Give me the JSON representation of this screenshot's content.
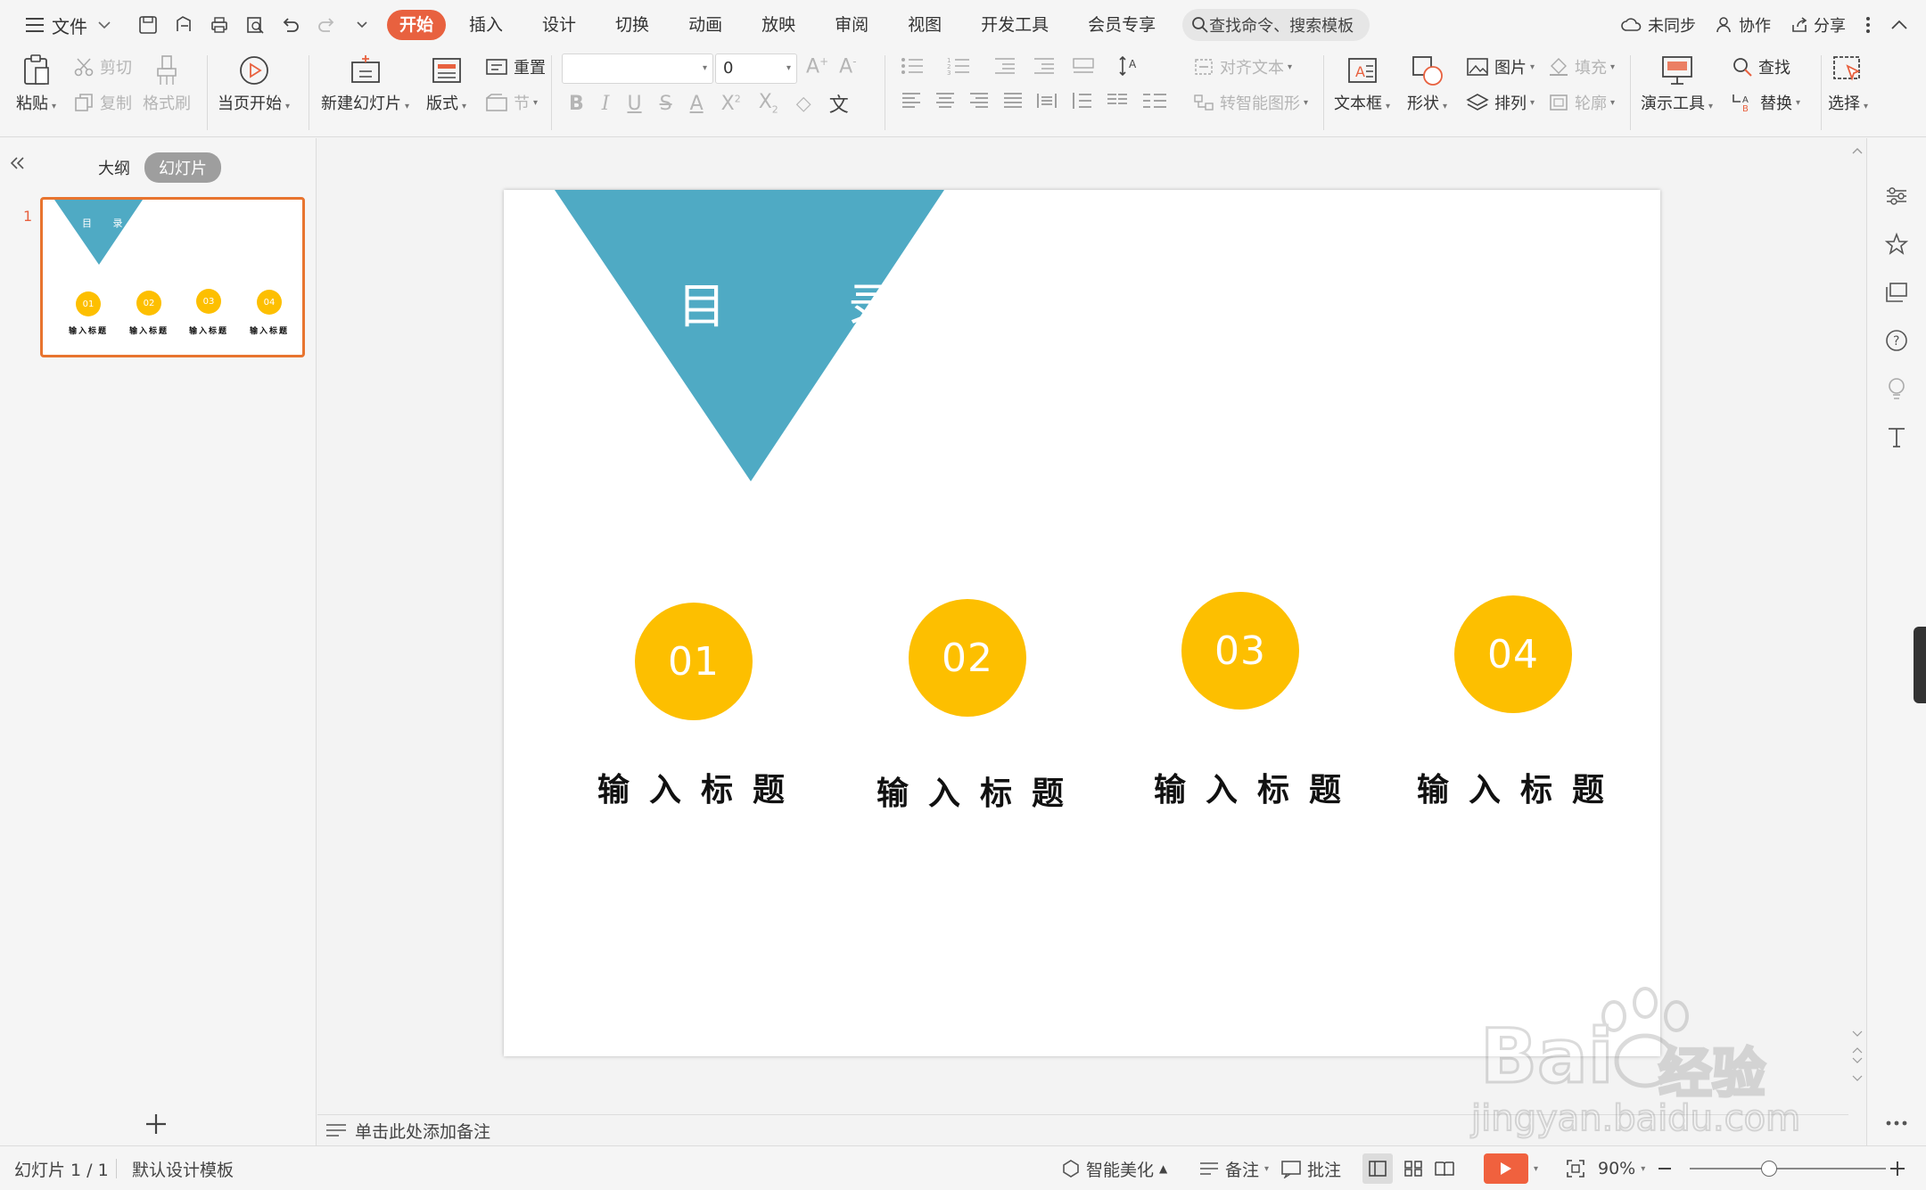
{
  "menubar": {
    "file_label": "文件",
    "tabs": [
      "开始",
      "插入",
      "设计",
      "切换",
      "动画",
      "放映",
      "审阅",
      "视图",
      "开发工具",
      "会员专享"
    ],
    "search_placeholder": "查找命令、搜索模板",
    "sync_label": "未同步",
    "collab_label": "协作",
    "share_label": "分享"
  },
  "ribbon": {
    "paste": "粘贴",
    "cut": "剪切",
    "copy": "复制",
    "format_painter": "格式刷",
    "from_current": "当页开始",
    "new_slide": "新建幻灯片",
    "layout": "版式",
    "reset": "重置",
    "section": "节",
    "font_size": "0",
    "align_text": "对齐文本",
    "smart_shape": "转智能图形",
    "textbox": "文本框",
    "shape": "形状",
    "picture": "图片",
    "fill": "填充",
    "arrange": "排列",
    "outline": "轮廓",
    "present_tools": "演示工具",
    "find": "查找",
    "replace": "替换",
    "select": "选择"
  },
  "left_panel": {
    "outline_tab": "大纲",
    "slides_tab": "幻灯片",
    "slide_number": "1"
  },
  "slide": {
    "title": "目 录",
    "items": [
      {
        "num": "01",
        "label": "输入标题"
      },
      {
        "num": "02",
        "label": "输入标题"
      },
      {
        "num": "03",
        "label": "输入标题"
      },
      {
        "num": "04",
        "label": "输入标题"
      }
    ],
    "thumb_title": "目 录",
    "thumb_label": "输入标题"
  },
  "notes": {
    "placeholder": "单击此处添加备注"
  },
  "statusbar": {
    "slide_info": "幻灯片 1 / 1",
    "template": "默认设计模板",
    "beautify": "智能美化",
    "notes": "备注",
    "comment": "批注",
    "zoom": "90%"
  },
  "watermark": {
    "brand": "Bai",
    "brand_suffix": "经验",
    "url": "jingyan.baidu.com"
  },
  "colors": {
    "accent": "#e8613f",
    "teal": "#4faac4",
    "yellow": "#fdbf00"
  }
}
